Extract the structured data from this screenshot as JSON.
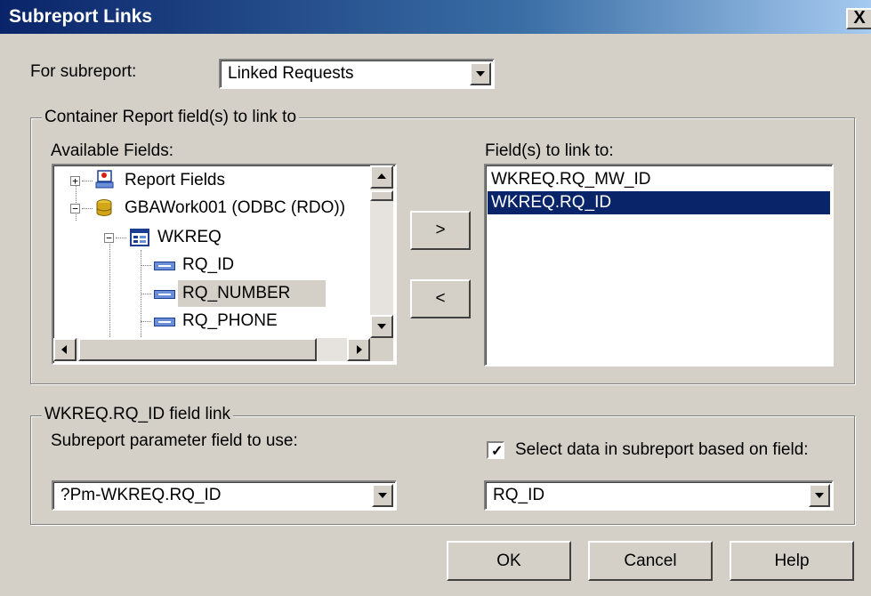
{
  "window": {
    "title": "Subreport Links",
    "close_glyph": "X"
  },
  "for_subreport": {
    "label": "For subreport:",
    "value": "Linked Requests"
  },
  "container_group": {
    "caption": "Container Report field(s) to link to",
    "available_label": "Available Fields:",
    "tree": {
      "report_fields": "Report Fields",
      "datasource": "GBAWork001 (ODBC (RDO))",
      "table": "WKREQ",
      "fields": [
        "RQ_ID",
        "RQ_NUMBER",
        "RQ_PHONE"
      ],
      "highlighted_field": "RQ_NUMBER"
    },
    "add_button": ">",
    "remove_button": "<",
    "linked_label": "Field(s) to link to:",
    "linked_items": [
      "WKREQ.RQ_MW_ID",
      "WKREQ.RQ_ID"
    ],
    "selected_linked": "WKREQ.RQ_ID"
  },
  "field_link_group": {
    "caption": "WKREQ.RQ_ID field link",
    "param_label": "Subreport parameter field to use:",
    "param_value": "?Pm-WKREQ.RQ_ID",
    "select_data_label": "Select data in subreport based on field:",
    "select_data_checked": true,
    "select_data_value": "RQ_ID"
  },
  "buttons": {
    "ok": "OK",
    "cancel": "Cancel",
    "help": "Help"
  },
  "colors": {
    "title_gradient_start": "#0a246a",
    "title_gradient_end": "#a6caf0",
    "face": "#d4d0c8",
    "selection": "#0a246a"
  }
}
